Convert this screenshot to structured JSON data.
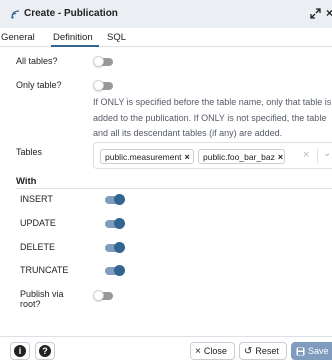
{
  "window": {
    "title": "Create - Publication",
    "icons": [
      "publication-icon",
      "expand-icon",
      "close-icon"
    ]
  },
  "tabs": [
    {
      "label": "General",
      "active": false
    },
    {
      "label": "Definition",
      "active": true
    },
    {
      "label": "SQL",
      "active": false
    }
  ],
  "fields": {
    "all_tables": {
      "label": "All tables?",
      "value": false
    },
    "only_table": {
      "label": "Only table?",
      "value": false
    },
    "help_text": "If ONLY is specified before the table name, only that table is added to the publication. If ONLY is not specified, the table and all its descendant tables (if any) are added.",
    "tables": {
      "label": "Tables",
      "selected": [
        "public.measurement",
        "public.foo_bar_baz"
      ],
      "remove_glyph": "×",
      "clear_glyph": "×",
      "dropdown_glyph": "⌄"
    }
  },
  "with": {
    "label": "With",
    "options": [
      {
        "label": "INSERT",
        "value": true
      },
      {
        "label": "UPDATE",
        "value": true
      },
      {
        "label": "DELETE",
        "value": true
      },
      {
        "label": "TRUNCATE",
        "value": true
      }
    ],
    "publish_via_root": {
      "label_line1": "Publish via",
      "label_line2": "root?",
      "value": false
    }
  },
  "footer": {
    "info_glyph": "i",
    "help_glyph": "?",
    "close_label": "Close",
    "reset_label": "Reset",
    "save_label": "Save"
  },
  "colors": {
    "accent": "#326690",
    "accent_light": "#7f9bbd",
    "switch_off": "#999999",
    "titlebar_bg": "#ebeef3"
  }
}
